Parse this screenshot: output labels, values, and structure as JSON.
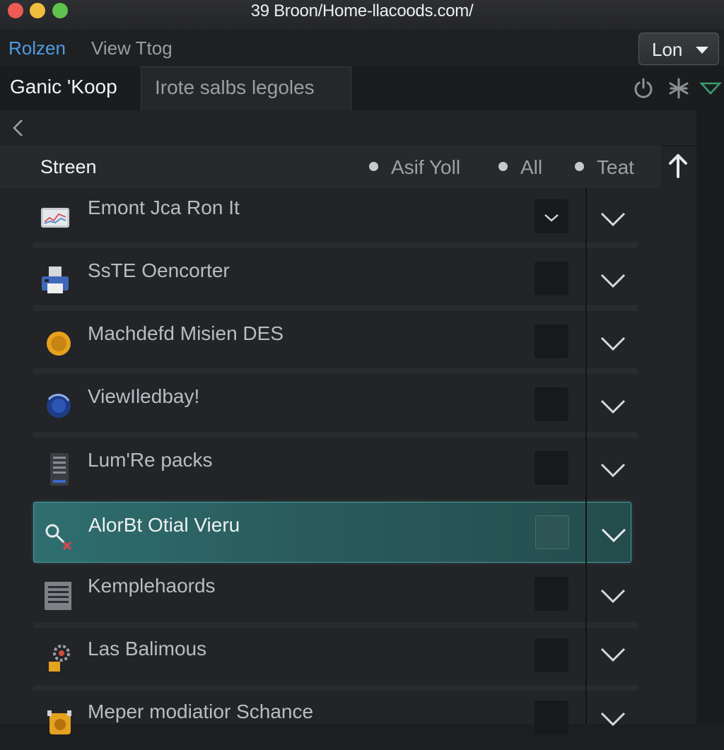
{
  "window": {
    "title": "39 Broon/Home-llacoods.com/"
  },
  "toolbar": {
    "nav_active": "Rolzen",
    "nav_inactive": "View Ttog",
    "dropdown_label": "Lon"
  },
  "tabs": [
    {
      "label": "Ganic 'Koop"
    },
    {
      "label": "Irote salbs legoles"
    }
  ],
  "list_header": {
    "title": "Streen",
    "filters": [
      "Asif Yoll",
      "All",
      "Teat"
    ]
  },
  "items": [
    {
      "label": "Emont Jca Ron It",
      "icon": "chart-icon",
      "checked": true
    },
    {
      "label": "SsTE Oencorter",
      "icon": "printer-icon",
      "checked": false
    },
    {
      "label": "Machdefd Misien DES",
      "icon": "coin-icon",
      "checked": false
    },
    {
      "label": "ViewIledbay!",
      "icon": "globe-icon",
      "checked": false
    },
    {
      "label": "Lum'Re packs",
      "icon": "server-icon",
      "checked": false
    },
    {
      "label": "AlorBt Otial Vieru",
      "icon": "key-icon",
      "checked": false,
      "selected": true
    },
    {
      "label": "Kemplehaords",
      "icon": "document-icon",
      "checked": false
    },
    {
      "label": "Las Balimous",
      "icon": "gear-lock-icon",
      "checked": false
    },
    {
      "label": "Meper modiatior Schance",
      "icon": "package-icon",
      "checked": false
    }
  ],
  "colors": {
    "accent": "#4e9de4",
    "selected_row": "#2f6f70",
    "background": "#1d1e20"
  }
}
